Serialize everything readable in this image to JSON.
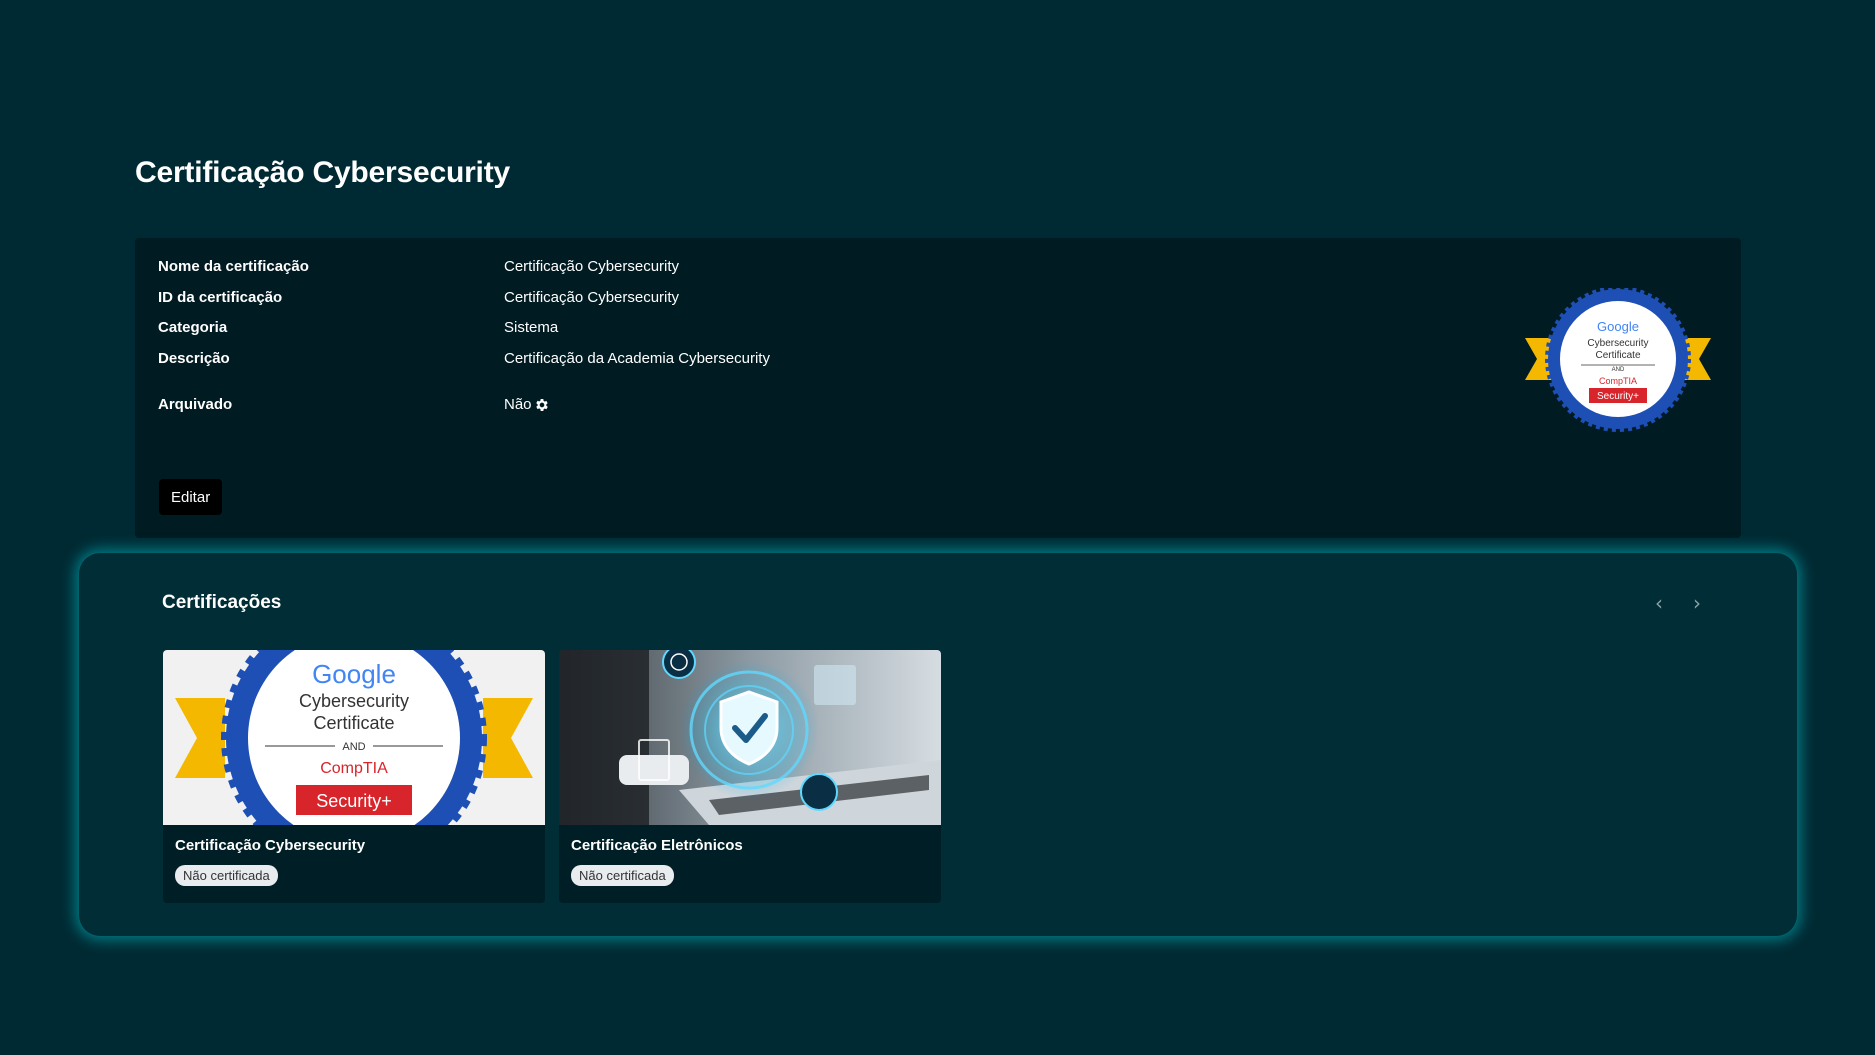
{
  "page": {
    "title": "Certificação Cybersecurity"
  },
  "details": {
    "rows": [
      {
        "label": "Nome da certificação",
        "value": "Certificação Cybersecurity"
      },
      {
        "label": "ID da certificação",
        "value": "Certificação Cybersecurity"
      },
      {
        "label": "Categoria",
        "value": "Sistema"
      },
      {
        "label": "Descrição",
        "value": "Certificação da Academia Cybersecurity"
      },
      {
        "label": "Arquivado",
        "value": "Não"
      }
    ],
    "edit_label": "Editar",
    "badge": {
      "brand": "Google",
      "line1": "Cybersecurity",
      "line2": "Certificate",
      "and": "AND",
      "partner": "CompTIA",
      "ribbon": "Security+"
    }
  },
  "certifications": {
    "title": "Certificações",
    "prev_icon": "‹",
    "next_icon": "›",
    "cards": [
      {
        "name": "Certificação Cybersecurity",
        "status": "Não certificada",
        "image": {
          "brand": "Google",
          "line1": "Cybersecurity",
          "line2": "Certificate",
          "and": "AND",
          "partner": "CompTIA",
          "ribbon": "Security+"
        }
      },
      {
        "name": "Certificação Eletrônicos",
        "status": "Não certificada"
      }
    ]
  },
  "colors": {
    "background": "#002a33",
    "card": "#001b21",
    "panel_glow": "#00bec8",
    "badge_blue": "#1d4fb5",
    "badge_yellow": "#f5b800",
    "security_red": "#d8242b"
  }
}
